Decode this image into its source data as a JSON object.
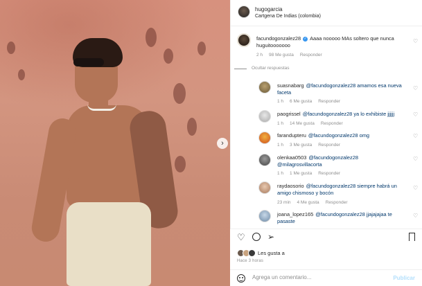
{
  "post": {
    "header": {
      "username": "hugogarcia",
      "location": "Cartgena De Indias (colombia)"
    },
    "comments": [
      {
        "username": "facundogonzalez28",
        "verified": true,
        "text": "Aaaa nooooo MAs soltero que nunca huguitooooooo",
        "time": "2 h",
        "likes": "98 Me gusta",
        "reply": "Responder",
        "hide_replies": "Ocultar respuestas"
      }
    ],
    "replies": [
      {
        "username": "suasnabarg",
        "text": "@facundogonzalez28 amamos esa nueva faceta",
        "time": "1 h",
        "likes": "6 Me gusta",
        "reply": "Responder"
      },
      {
        "username": "paogrissel",
        "text": "@facundogonzalez28 ya lo exhibiste jjjjjj",
        "time": "1 h",
        "likes": "14 Me gusta",
        "reply": "Responder"
      },
      {
        "username": "farandupteru",
        "text": "@facundogonzalez28 omg",
        "time": "1 h",
        "likes": "3 Me gusta",
        "reply": "Responder"
      },
      {
        "username": "olenkaa0503",
        "text": "@facundogonzalez28 @milagrosvillacorta",
        "time": "1 h",
        "likes": "1 Me gusta",
        "reply": "Responder"
      },
      {
        "username": "raydaosorio",
        "text": "@facundogonzalez28 siempre habrá un amigo chismoso y bocón",
        "time": "23 min",
        "likes": "4 Me gusta",
        "reply": "Responder"
      },
      {
        "username": "joana_lopez165",
        "text": "@facundogonzalez28 jjajajajaa te pasaste",
        "time": "",
        "likes": "",
        "reply": ""
      }
    ],
    "footer": {
      "likes_text": "Les gusta a",
      "time_ago": "Hace 3 horas",
      "comment_placeholder": "Agrega un comentario...",
      "publish_label": "Publicar"
    }
  },
  "colors": {
    "link": "#00376b",
    "muted": "#8e8e8e",
    "verified": "#3897f0"
  }
}
